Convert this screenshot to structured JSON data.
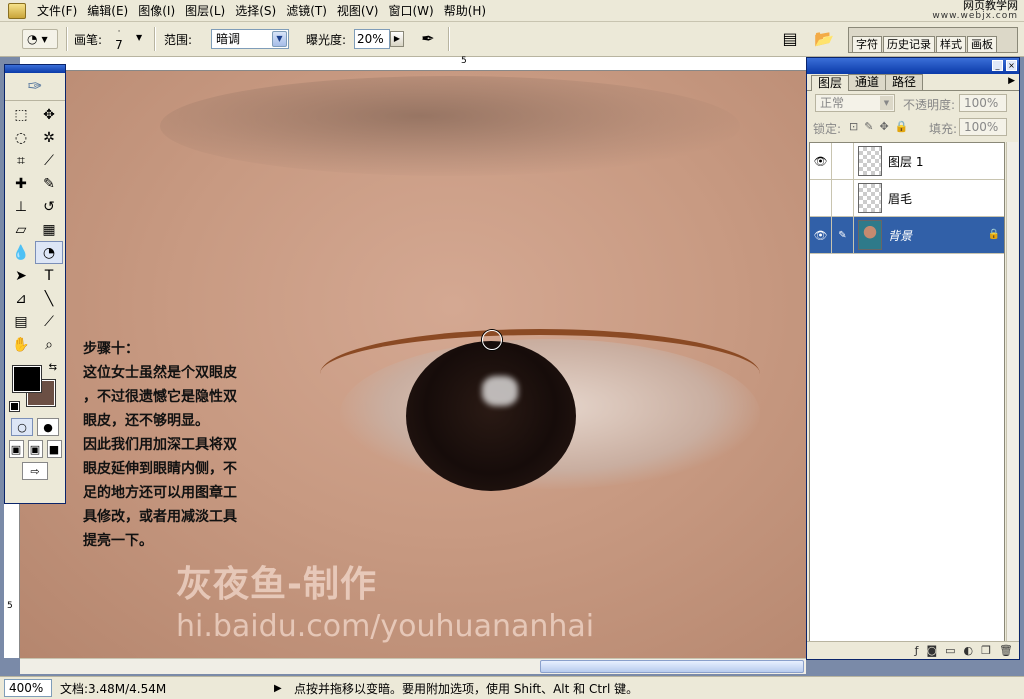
{
  "menubar": {
    "items": [
      "文件(F)",
      "编辑(E)",
      "图像(I)",
      "图层(L)",
      "选择(S)",
      "滤镜(T)",
      "视图(V)",
      "窗口(W)",
      "帮助(H)"
    ],
    "watermark_line1": "网页教学网",
    "watermark_line2": "www.webjx.com"
  },
  "options": {
    "brush_label": "画笔:",
    "brush_size": "7",
    "range_label": "范围:",
    "range_value": "暗调",
    "exposure_label": "曝光度:",
    "exposure_value": "20%",
    "palette_tabs": [
      "字符",
      "历史记录",
      "样式",
      "画板"
    ]
  },
  "ruler": {
    "top_label": "5",
    "left_label": "5"
  },
  "canvas": {
    "step_title": "步骤十：",
    "step_lines": [
      "这位女士虽然是个双眼皮",
      "，不过很遗憾它是隐性双",
      "眼皮，还不够明显。",
      "因此我们用加深工具将双",
      "眼皮延伸到眼睛内侧，不",
      "足的地方还可以用图章工",
      "具修改，或者用减淡工具",
      "提亮一下。"
    ],
    "credit": "灰夜鱼-制作",
    "url": "hi.baidu.com/youhuananhai"
  },
  "toolbox": {
    "foreground_color": "#000000",
    "background_color": "#6b4f44"
  },
  "layers_panel": {
    "tabs": [
      "图层",
      "通道",
      "路径"
    ],
    "blend_mode": "正常",
    "opacity_label": "不透明度:",
    "opacity_value": "100%",
    "lock_label": "锁定:",
    "fill_label": "填充:",
    "fill_value": "100%",
    "layers": [
      {
        "name": "图层 1",
        "visible": true,
        "selected": false
      },
      {
        "name": "眉毛",
        "visible": false,
        "selected": false
      },
      {
        "name": "背景",
        "visible": true,
        "selected": true
      }
    ]
  },
  "statusbar": {
    "zoom": "400%",
    "doc_info": "文档:3.48M/4.54M",
    "hint": "点按并拖移以变暗。要用附加选项，使用 Shift、Alt 和 Ctrl 键。"
  }
}
